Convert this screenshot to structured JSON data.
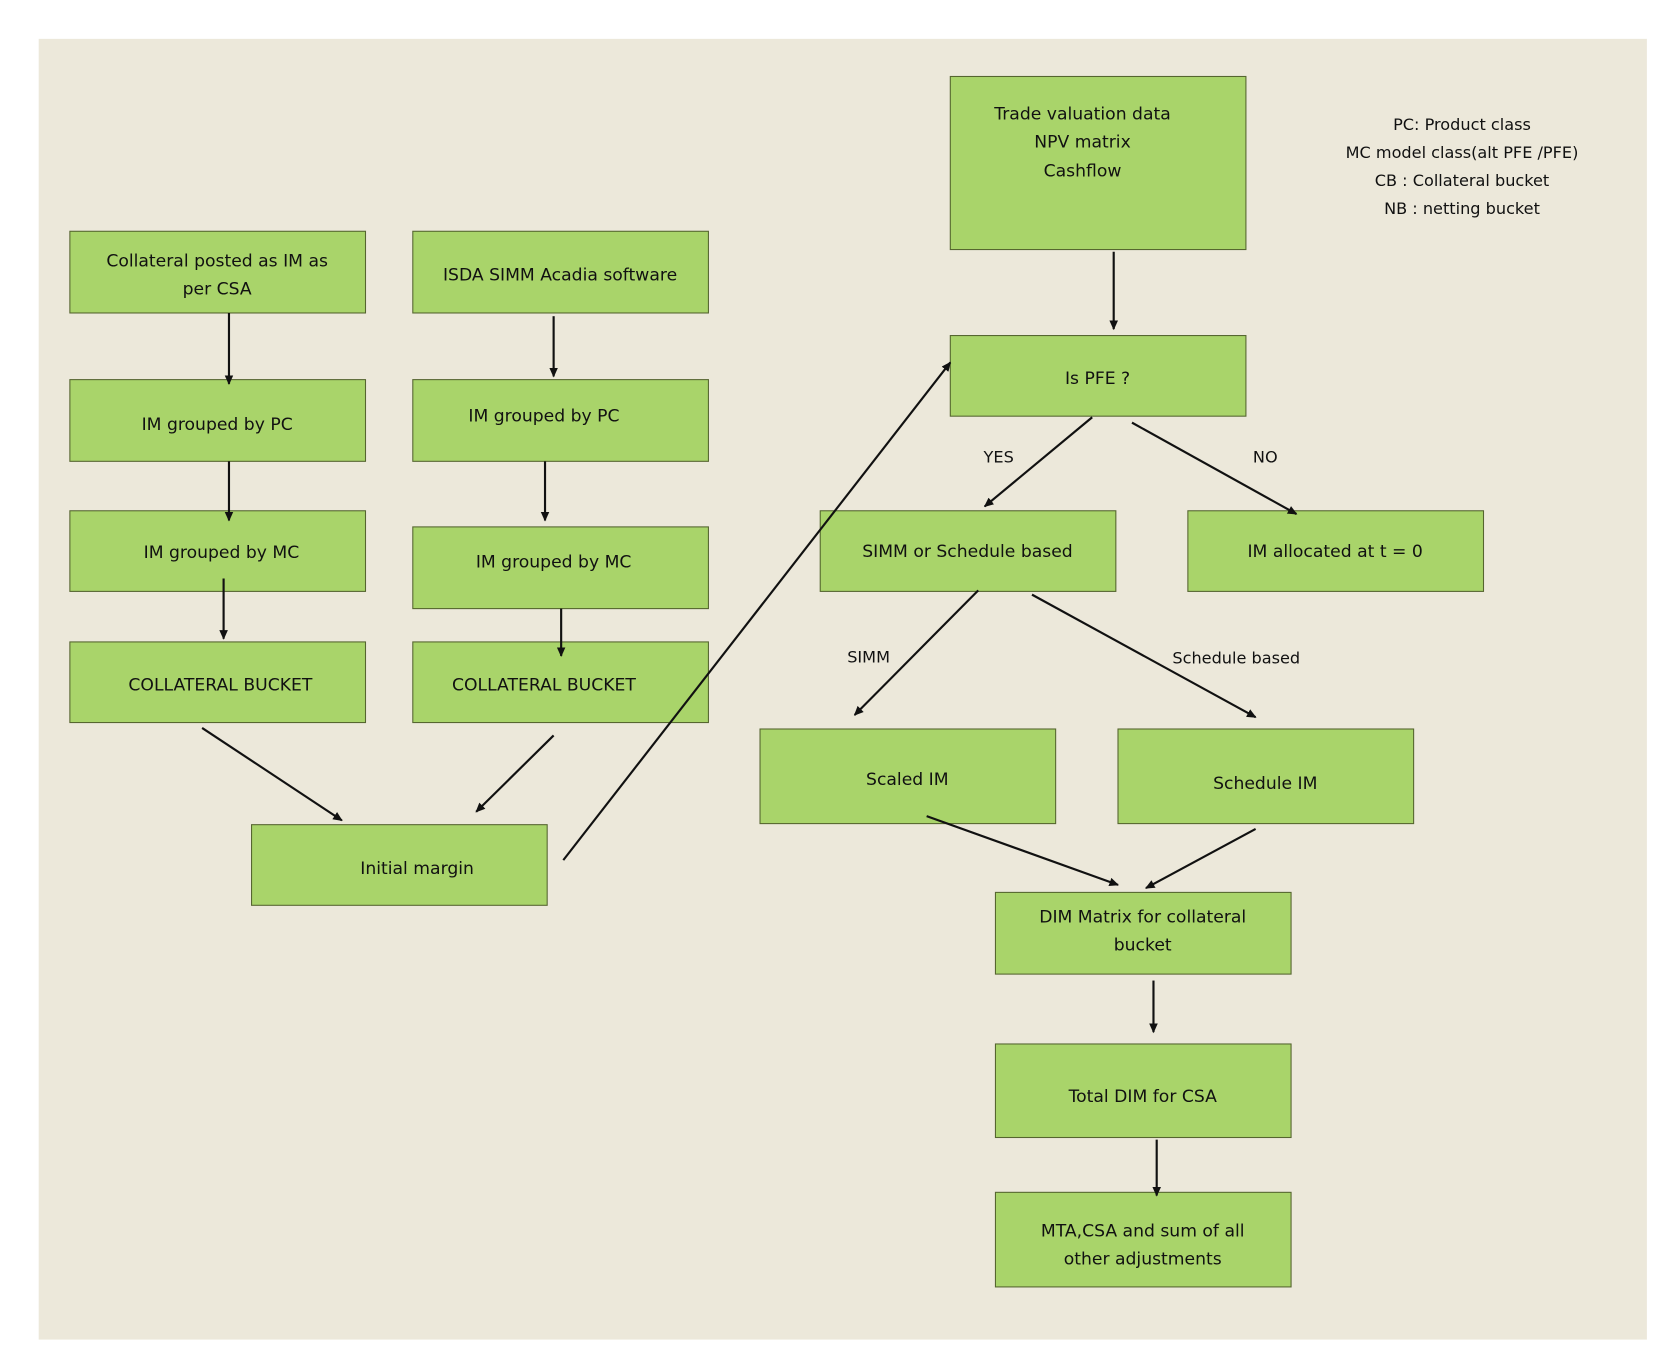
{
  "colors": {
    "box_fill": "#a9d46a",
    "paper": "#ece8da",
    "line": "#111111"
  },
  "legend": [
    "PC: Product class",
    "MC model class(alt PFE /PFE)",
    "CB : Collateral bucket",
    "NB : netting bucket"
  ],
  "boxes": {
    "collateral_posted": [
      "Collateral posted as IM as",
      "per CSA"
    ],
    "isda_simm": "ISDA SIMM Acadia software",
    "im_pc_left": "IM grouped by PC",
    "im_pc_right": "IM grouped by PC",
    "im_mc_left": "IM grouped by MC",
    "im_mc_right": "IM grouped by MC",
    "cb_left": "COLLATERAL BUCKET",
    "cb_right": "COLLATERAL BUCKET",
    "initial_margin": "Initial margin",
    "trade_valuation": [
      "Trade valuation data",
      "NPV matrix",
      "Cashflow"
    ],
    "is_pfe": "Is PFE ?",
    "simm_or_schedule": "SIMM or Schedule based",
    "im_allocated": "IM allocated at t = 0",
    "scaled_im": "Scaled IM",
    "schedule_im": "Schedule IM",
    "dim_matrix": [
      "DIM Matrix for collateral",
      "bucket"
    ],
    "total_dim": "Total DIM for CSA",
    "mta": [
      "MTA,CSA and sum of all",
      "other adjustments"
    ]
  },
  "edge_labels": {
    "yes": "YES",
    "no": "NO",
    "simm": "SIMM",
    "schedule": "Schedule based"
  }
}
